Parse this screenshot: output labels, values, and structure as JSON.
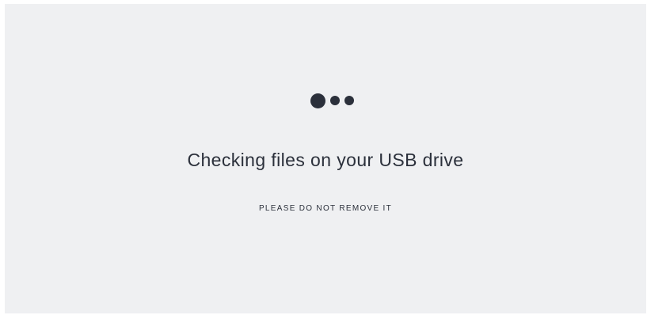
{
  "screen": {
    "title": "Checking files on your USB drive",
    "subtitle": "PLEASE DO NOT REMOVE IT",
    "loader_icon": "loading-dots-icon"
  },
  "colors": {
    "background": "#eff0f2",
    "text": "#2b303b"
  }
}
